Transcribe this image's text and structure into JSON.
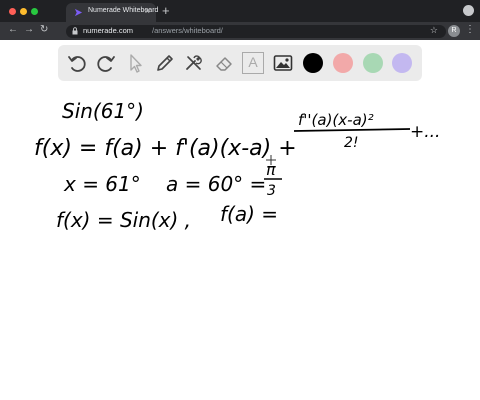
{
  "browser": {
    "tab_title": "Numerade Whiteboard",
    "tab_close": "×",
    "new_tab": "+",
    "url_host": "numerade.com",
    "url_path": "/answers/whiteboard/",
    "profile_initial": "R",
    "window_controls": [
      "#ff5f57",
      "#febc2e",
      "#28c840"
    ]
  },
  "toolbar": {
    "tools": [
      "undo-icon",
      "redo-icon",
      "select-icon",
      "pen-icon",
      "tools-icon",
      "eraser-icon",
      "text-icon",
      "image-icon"
    ],
    "text_tool_label": "A",
    "colors": [
      "#000000",
      "#f2a9a9",
      "#a8d8b4",
      "#c3b8f0"
    ]
  },
  "whiteboard": {
    "line1": "Sin(61°)",
    "line2_main": "f(x) = f(a) + f'(a)(x-a) +",
    "line2_numerator": "f''(a)(x-a)²",
    "line2_denominator": "2!",
    "line2_tail": "+...",
    "line3_x": "x = 61°",
    "line3_a": "a = 60° =",
    "line3_pi": "π",
    "line3_three": "3",
    "line4_f": "f(x) = Sin(x) ,",
    "line4_fa": "f(a) ="
  }
}
